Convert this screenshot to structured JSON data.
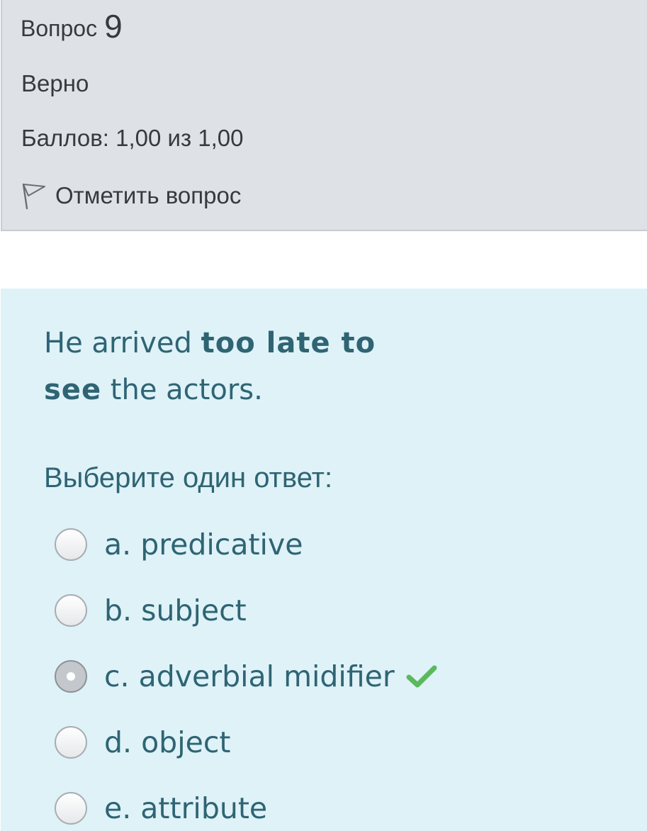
{
  "question_info": {
    "label": "Вопрос",
    "number": "9",
    "state": "Верно",
    "grade": "Баллов: 1,00 из 1,00",
    "flag_label": "Отметить вопрос"
  },
  "question": {
    "text_part1": "He arrived ",
    "text_bold1": "too late to",
    "text_bold2": "see",
    "text_part2": " the  actors.",
    "prompt": "Выберите один ответ:"
  },
  "answers": [
    {
      "label": "a. predicative",
      "selected": false
    },
    {
      "label": "b. subject",
      "selected": false
    },
    {
      "label": "c. adverbial midifier",
      "selected": true,
      "correct": true
    },
    {
      "label": "d. object",
      "selected": false
    },
    {
      "label": "e. attribute",
      "selected": false
    }
  ],
  "colors": {
    "info_bg": "#dee2e6",
    "content_bg": "#def2f8",
    "text_teal": "#2f6473",
    "correct_green": "#5cb85c"
  },
  "icons": {
    "flag": "flag-icon",
    "correct": "check-icon"
  }
}
